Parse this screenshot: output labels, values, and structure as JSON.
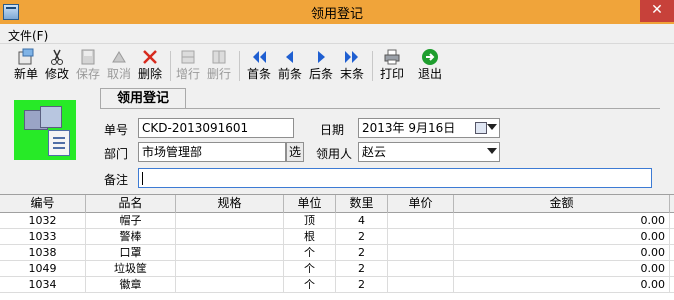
{
  "window": {
    "title": "领用登记",
    "close_glyph": "✕"
  },
  "menu": {
    "file_label": "文件(F)"
  },
  "toolbar": {
    "buttons": [
      {
        "label": "新单",
        "icon": "new-doc-icon"
      },
      {
        "label": "修改",
        "icon": "scissors-icon"
      },
      {
        "label": "保存",
        "icon": "save-icon",
        "disabled": true
      },
      {
        "label": "取消",
        "icon": "cancel-icon",
        "disabled": true
      },
      {
        "label": "删除",
        "icon": "delete-icon"
      },
      {
        "label": "增行",
        "icon": "add-row-icon",
        "disabled": true
      },
      {
        "label": "删行",
        "icon": "delete-row-icon",
        "disabled": true
      },
      {
        "label": "首条",
        "icon": "first-record-icon"
      },
      {
        "label": "前条",
        "icon": "prev-record-icon"
      },
      {
        "label": "后条",
        "icon": "next-record-icon"
      },
      {
        "label": "末条",
        "icon": "last-record-icon"
      },
      {
        "label": "打印",
        "icon": "printer-icon"
      },
      {
        "label": "退出",
        "icon": "exit-icon"
      }
    ]
  },
  "form": {
    "tab_label": "领用登记",
    "number_label": "单号",
    "number_value": "CKD-2013091601",
    "date_label": "日期",
    "date_value": "2013年 9月16日",
    "dept_label": "部门",
    "dept_value": "市场管理部",
    "dept_pick_label": "选",
    "receiver_label": "领用人",
    "receiver_value": "赵云",
    "remark_label": "备注",
    "remark_value": ""
  },
  "grid": {
    "columns": [
      "编号",
      "品名",
      "规格",
      "单位",
      "数里",
      "单价",
      "金额"
    ],
    "rows": [
      [
        "1032",
        "帽子",
        "",
        "顶",
        "4",
        "",
        "0.00"
      ],
      [
        "1033",
        "警棒",
        "",
        "根",
        "2",
        "",
        "0.00"
      ],
      [
        "1038",
        "口罩",
        "",
        "个",
        "2",
        "",
        "0.00"
      ],
      [
        "1049",
        "垃圾筐",
        "",
        "个",
        "2",
        "",
        "0.00"
      ],
      [
        "1034",
        "徽章",
        "",
        "个",
        "2",
        "",
        "0.00"
      ]
    ]
  },
  "colors": {
    "titlebar": "#f0a43a",
    "close": "#c7413a",
    "logo_bg": "#27ea27",
    "nav_arrow": "#1f5fd1",
    "exit_green": "#1e9e2e",
    "delete_red": "#d62a1e"
  }
}
